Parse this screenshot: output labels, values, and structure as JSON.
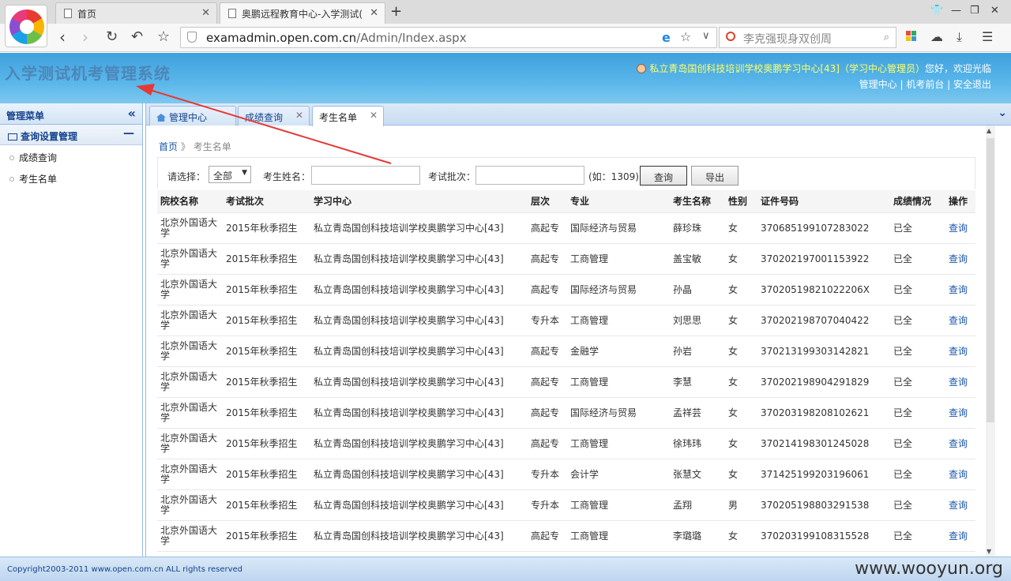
{
  "browser": {
    "tabs": [
      {
        "title": "首页",
        "active": false
      },
      {
        "title": "奥鹏远程教育中心-入学测试(",
        "active": true
      }
    ],
    "address": {
      "host": "examadmin.open.com.cn",
      "path": "/Admin/Index.aspx"
    },
    "search_placeholder": "李克强现身双创周"
  },
  "header": {
    "system_title": "入学测试机考管理系统",
    "user": "私立青岛国创科技培训学校奥鹏学习中心[43]（学习中心管理员）",
    "greeting": "您好，欢迎光临",
    "links_text": "管理中心 | 机考前台 | 安全退出"
  },
  "sidebar": {
    "title": "管理菜单",
    "group": "查询设置管理",
    "items": [
      "成绩查询",
      "考生名单"
    ]
  },
  "page_tabs": [
    "管理中心",
    "成绩查询",
    "考生名单"
  ],
  "breadcrumb": {
    "home": "首页",
    "sep": "》",
    "current": "考生名单"
  },
  "query": {
    "select_label": "请选择：",
    "select_value": "全部",
    "name_label": "考生姓名：",
    "batch_label": "考试批次：",
    "batch_hint": "(如：1309)",
    "search_button": "查询",
    "export_button": "导出"
  },
  "table": {
    "headers": [
      "院校名称",
      "考试批次",
      "学习中心",
      "层次",
      "专业",
      "考生名称",
      "性别",
      "证件号码",
      "成绩情况",
      "操作"
    ],
    "rows": [
      [
        "北京外国语大学",
        "2015年秋季招生",
        "私立青岛国创科技培训学校奥鹏学习中心[43]",
        "高起专",
        "国际经济与贸易",
        "薛珍珠",
        "女",
        "370685199107283022",
        "已全",
        "查询"
      ],
      [
        "北京外国语大学",
        "2015年秋季招生",
        "私立青岛国创科技培训学校奥鹏学习中心[43]",
        "高起专",
        "工商管理",
        "盖宝敏",
        "女",
        "370202197001153922",
        "已全",
        "查询"
      ],
      [
        "北京外国语大学",
        "2015年秋季招生",
        "私立青岛国创科技培训学校奥鹏学习中心[43]",
        "高起专",
        "国际经济与贸易",
        "孙晶",
        "女",
        "37020519821022206X",
        "已全",
        "查询"
      ],
      [
        "北京外国语大学",
        "2015年秋季招生",
        "私立青岛国创科技培训学校奥鹏学习中心[43]",
        "专升本",
        "工商管理",
        "刘思思",
        "女",
        "370202198707040422",
        "已全",
        "查询"
      ],
      [
        "北京外国语大学",
        "2015年秋季招生",
        "私立青岛国创科技培训学校奥鹏学习中心[43]",
        "高起专",
        "金融学",
        "孙岩",
        "女",
        "370213199303142821",
        "已全",
        "查询"
      ],
      [
        "北京外国语大学",
        "2015年秋季招生",
        "私立青岛国创科技培训学校奥鹏学习中心[43]",
        "高起专",
        "工商管理",
        "李慧",
        "女",
        "370202198904291829",
        "已全",
        "查询"
      ],
      [
        "北京外国语大学",
        "2015年秋季招生",
        "私立青岛国创科技培训学校奥鹏学习中心[43]",
        "高起专",
        "国际经济与贸易",
        "孟祥芸",
        "女",
        "370203198208102621",
        "已全",
        "查询"
      ],
      [
        "北京外国语大学",
        "2015年秋季招生",
        "私立青岛国创科技培训学校奥鹏学习中心[43]",
        "高起专",
        "工商管理",
        "徐玮玮",
        "女",
        "370214198301245028",
        "已全",
        "查询"
      ],
      [
        "北京外国语大学",
        "2015年秋季招生",
        "私立青岛国创科技培训学校奥鹏学习中心[43]",
        "专升本",
        "会计学",
        "张慧文",
        "女",
        "371425199203196061",
        "已全",
        "查询"
      ],
      [
        "北京外国语大学",
        "2015年秋季招生",
        "私立青岛国创科技培训学校奥鹏学习中心[43]",
        "专升本",
        "工商管理",
        "孟翔",
        "男",
        "370205198803291538",
        "已全",
        "查询"
      ],
      [
        "北京外国语大学",
        "2015年秋季招生",
        "私立青岛国创科技培训学校奥鹏学习中心[43]",
        "高起专",
        "工商管理",
        "李璐璐",
        "女",
        "370203199108315528",
        "已全",
        "查询"
      ]
    ]
  },
  "footer": {
    "copyright": "Copyright2003-2011 www.open.com.cn ALL rights reserved",
    "watermark": "www.wooyun.org"
  },
  "colors": {
    "header_blue": "#4aa9e1",
    "link_blue": "#1a55a8",
    "annotation_red": "#e53935"
  }
}
